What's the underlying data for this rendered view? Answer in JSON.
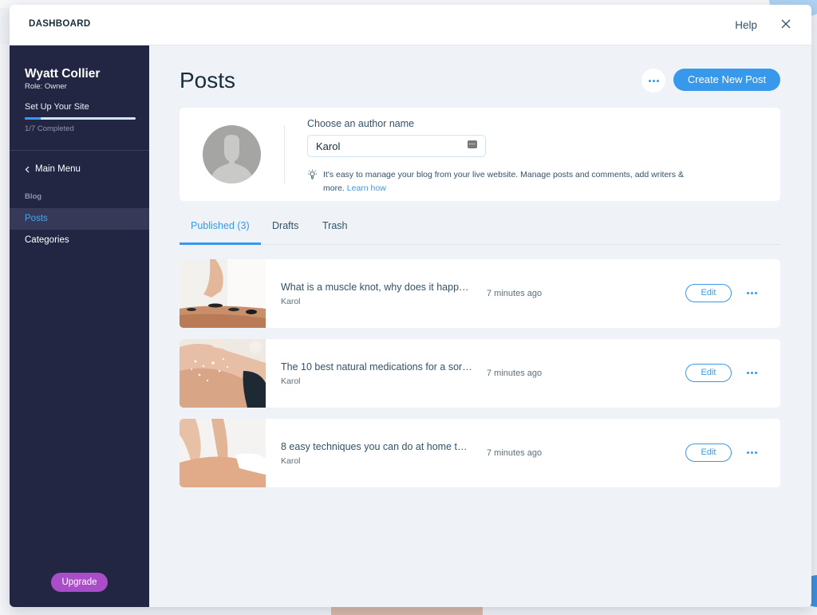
{
  "modal": {
    "title": "DASHBOARD",
    "help_label": "Help",
    "close_icon": "close-icon"
  },
  "sidebar": {
    "user_name": "Wyatt Collier",
    "user_role": "Role: Owner",
    "setup_title": "Set Up Your Site",
    "setup_progress": {
      "completed": 1,
      "total": 7,
      "fraction": 0.143
    },
    "setup_progress_text": "1/7 Completed",
    "main_menu_label": "Main Menu",
    "section_label": "Blog",
    "items": [
      {
        "label": "Posts",
        "active": true
      },
      {
        "label": "Categories",
        "active": false
      }
    ],
    "upgrade_label": "Upgrade"
  },
  "content": {
    "page_title": "Posts",
    "more_icon": "more-horizontal-icon",
    "create_button_label": "Create New Post",
    "author": {
      "label": "Choose an author name",
      "value": "Karol",
      "placeholder": "",
      "tip_text": "It's easy to manage your blog from your live website. Manage posts and comments, add writers & more. ",
      "tip_link": "Learn how"
    },
    "tabs": [
      {
        "label": "Published (3)",
        "active": true
      },
      {
        "label": "Drafts",
        "active": false
      },
      {
        "label": "Trash",
        "active": false
      }
    ],
    "posts": [
      {
        "title": "What is a muscle knot, why does it happ…",
        "author": "Karol",
        "time": "7 minutes ago",
        "edit_label": "Edit",
        "thumbnail": "hot-stone-massage"
      },
      {
        "title": "The 10 best natural medications for a sor…",
        "author": "Karol",
        "time": "7 minutes ago",
        "edit_label": "Edit",
        "thumbnail": "salt-scrub-back"
      },
      {
        "title": "8 easy techniques you can do at home t…",
        "author": "Karol",
        "time": "7 minutes ago",
        "edit_label": "Edit",
        "thumbnail": "back-massage"
      }
    ]
  },
  "colors": {
    "accent": "#3899ec",
    "sidebar_bg": "#232642",
    "upgrade": "#aa4dc8",
    "content_bg": "#eff3f7"
  }
}
